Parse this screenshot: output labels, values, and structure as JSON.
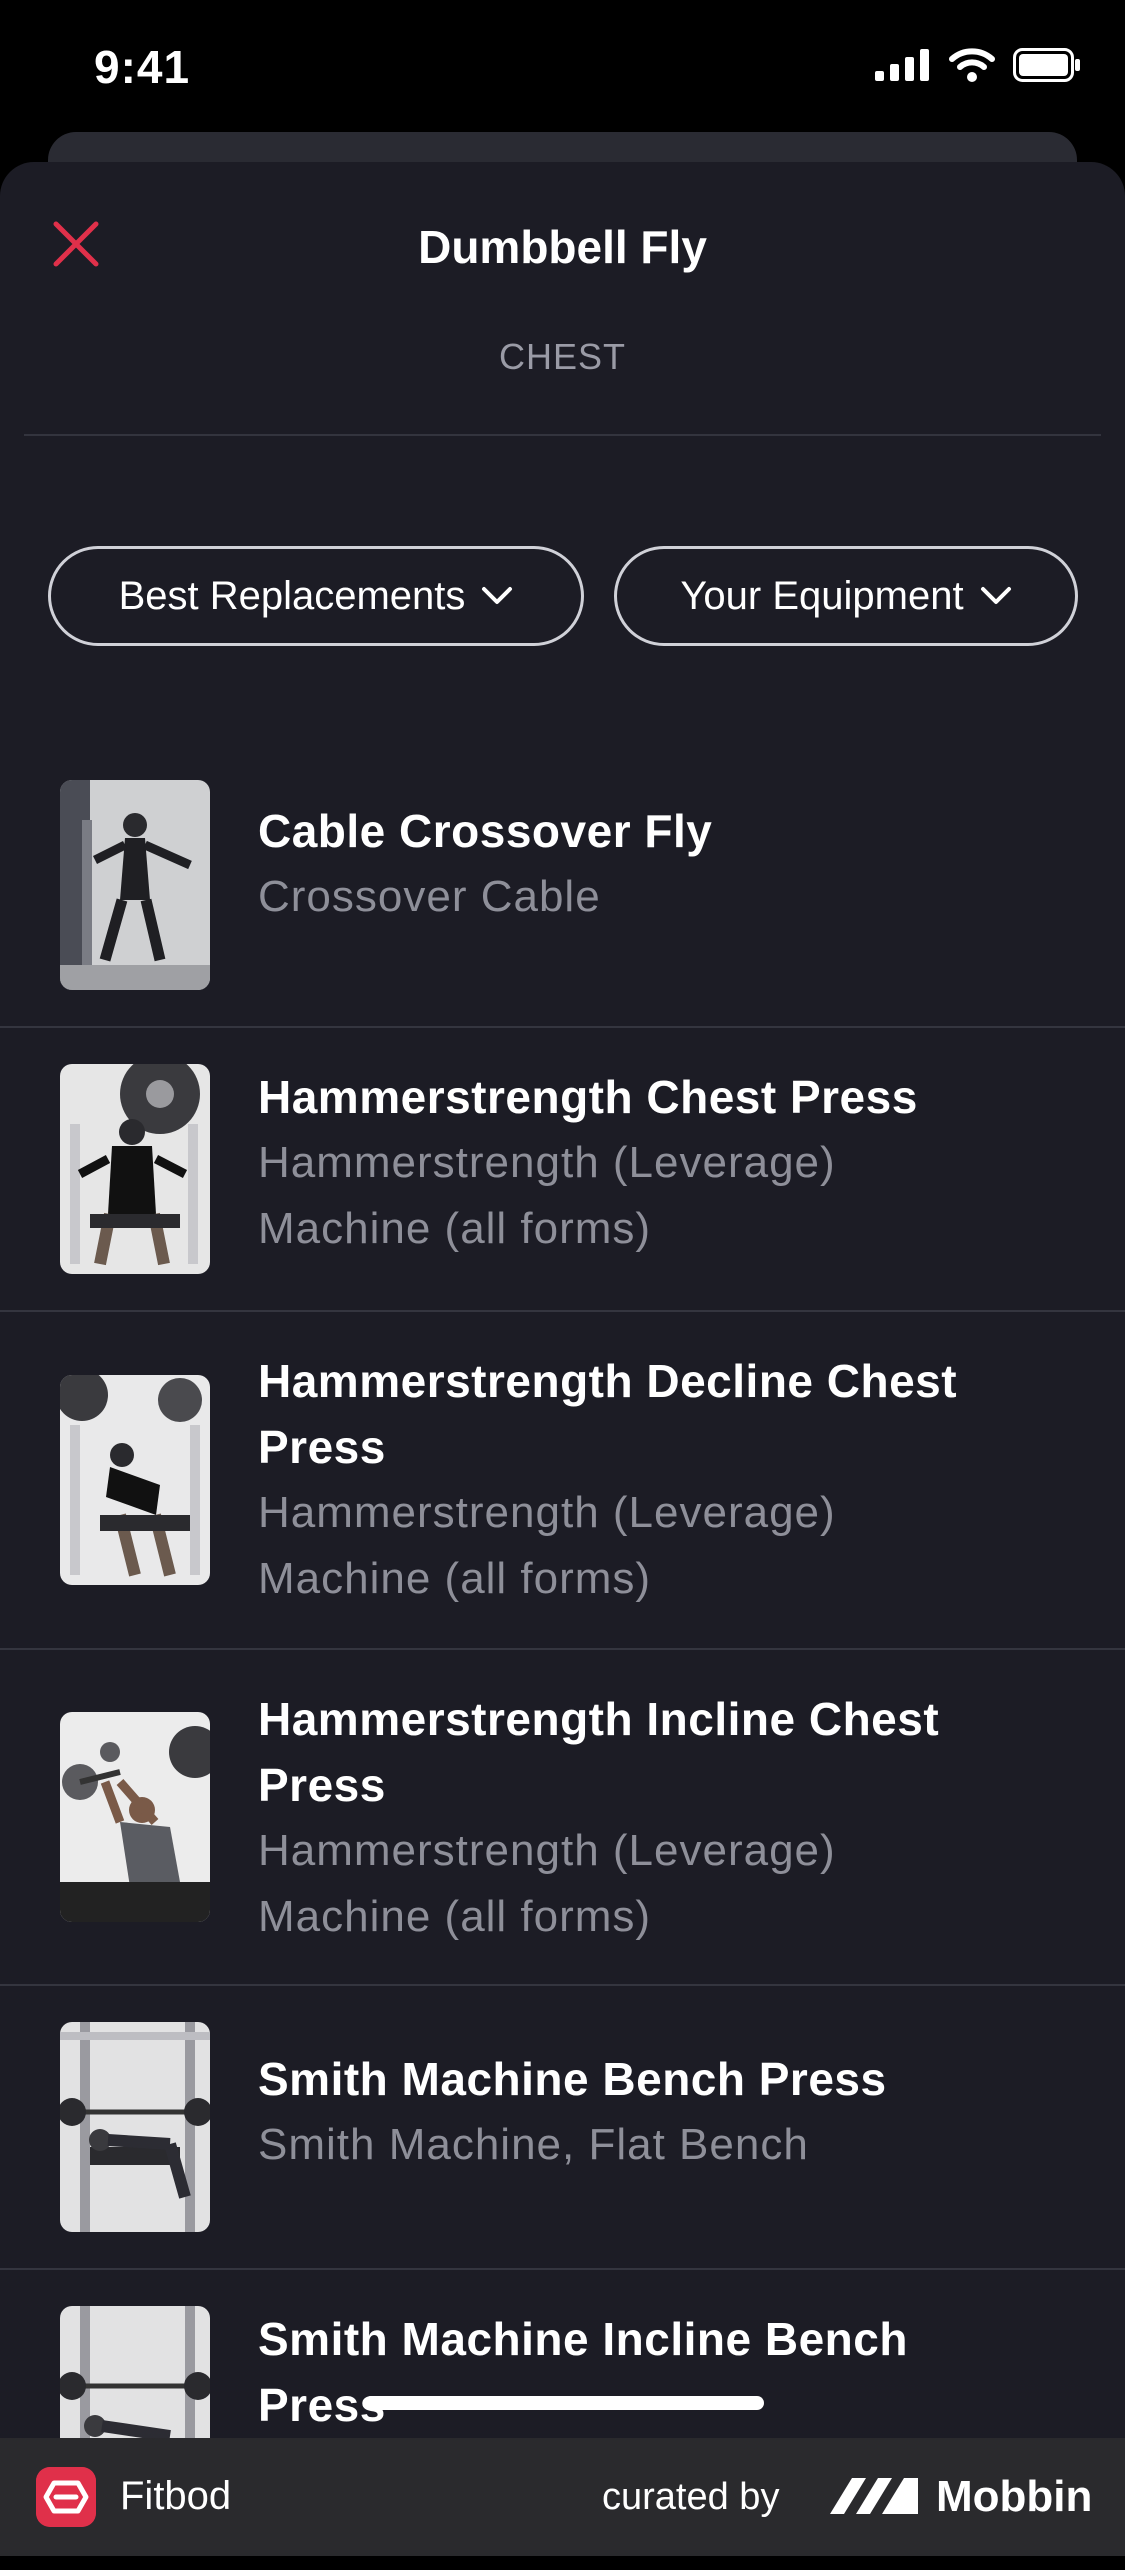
{
  "status_bar": {
    "time": "9:41"
  },
  "header": {
    "title": "Dumbbell Fly",
    "subtitle": "CHEST"
  },
  "filters": [
    {
      "label": "Best Replacements"
    },
    {
      "label": "Your Equipment"
    }
  ],
  "exercises": [
    {
      "name_lines": [
        "Cable Crossover Fly"
      ],
      "equipment_lines": [
        "Crossover Cable"
      ]
    },
    {
      "name_lines": [
        "Hammerstrength Chest Press"
      ],
      "equipment_lines": [
        "Hammerstrength (Leverage)",
        "Machine (all forms)"
      ]
    },
    {
      "name_lines": [
        "Hammerstrength Decline Chest",
        "Press"
      ],
      "equipment_lines": [
        "Hammerstrength (Leverage)",
        "Machine (all forms)"
      ]
    },
    {
      "name_lines": [
        "Hammerstrength Incline Chest",
        "Press"
      ],
      "equipment_lines": [
        "Hammerstrength (Leverage)",
        "Machine (all forms)"
      ]
    },
    {
      "name_lines": [
        "Smith Machine Bench Press"
      ],
      "equipment_lines": [
        "Smith Machine, Flat Bench"
      ]
    },
    {
      "name_lines": [
        "Smith Machine Incline Bench",
        "Press"
      ],
      "equipment_lines": []
    }
  ],
  "footer": {
    "brand": "Fitbod",
    "curated_by": "curated by",
    "curator": "Mobbin"
  },
  "colors": {
    "accent": "#e0304a",
    "sheet_bg": "#1c1c25",
    "muted_text": "#8e8f99"
  }
}
